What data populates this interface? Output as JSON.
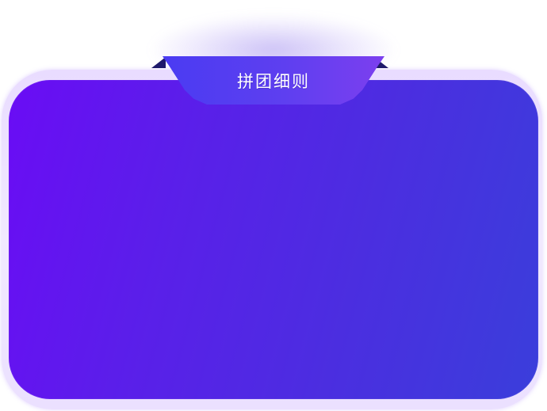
{
  "tab": {
    "title": "拼团细则"
  },
  "colors": {
    "card_gradient_start": "#6a0cf5",
    "card_gradient_end": "#3a3edb",
    "tab_gradient_start": "#4a3bf2",
    "tab_gradient_end": "#7c3fef",
    "frame": "#ece2ff",
    "fold": "#1f1a6b"
  }
}
